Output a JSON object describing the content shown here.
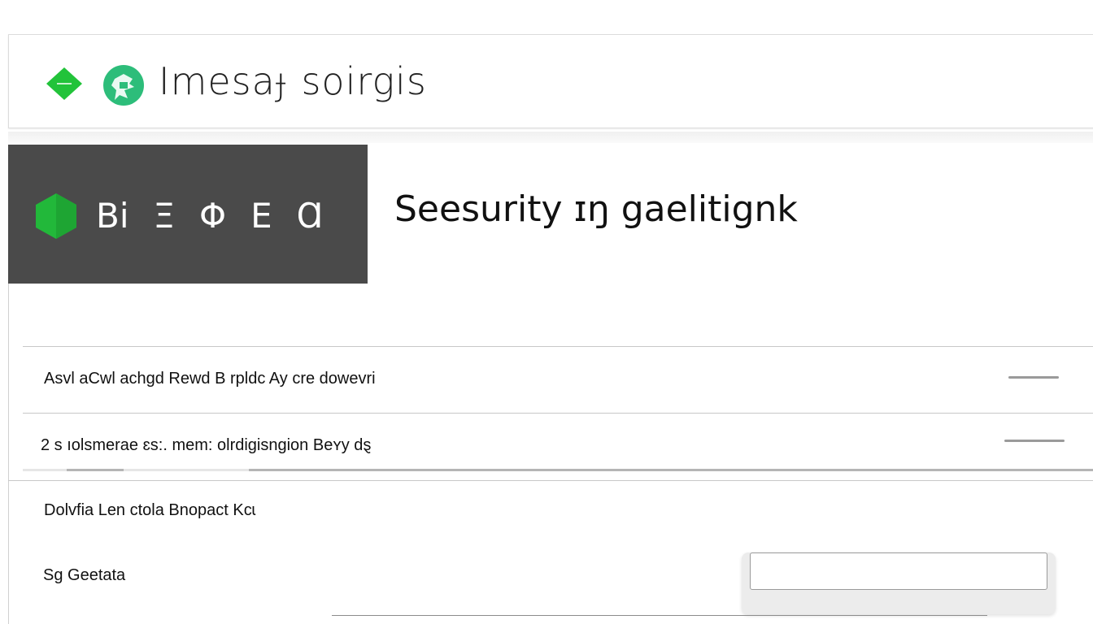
{
  "header": {
    "title": "Imesaɟ soirgis",
    "logo_left_icon": "green-diamond-icon",
    "logo_round_icon": "green-emblem-icon",
    "accent_color": "#22c33a",
    "emblem_color": "#2dbd7a"
  },
  "nav": {
    "icon": "green-hexagon-icon",
    "items": [
      {
        "label": "Bi"
      },
      {
        "label": "Ξ"
      },
      {
        "label": "Φ"
      },
      {
        "label": "Ε"
      },
      {
        "label": "Ɑ"
      }
    ],
    "background": "#4a4a4a"
  },
  "main": {
    "section_title": "Seesurity ɪŋ gaelitignk",
    "rows": [
      {
        "label": "Asvl aCwl achgd Rewd B rpldc  Ay cre  dowevri"
      },
      {
        "label": "2 s ıolsmerae ɛs:. mem: olrdigisngion Beʏy dȿ"
      }
    ],
    "label_3": "Dolvfia  Len ctola Bnopact Kcɩ",
    "label_4": "Sg Geetata",
    "input": {
      "value": "",
      "placeholder": ""
    }
  }
}
